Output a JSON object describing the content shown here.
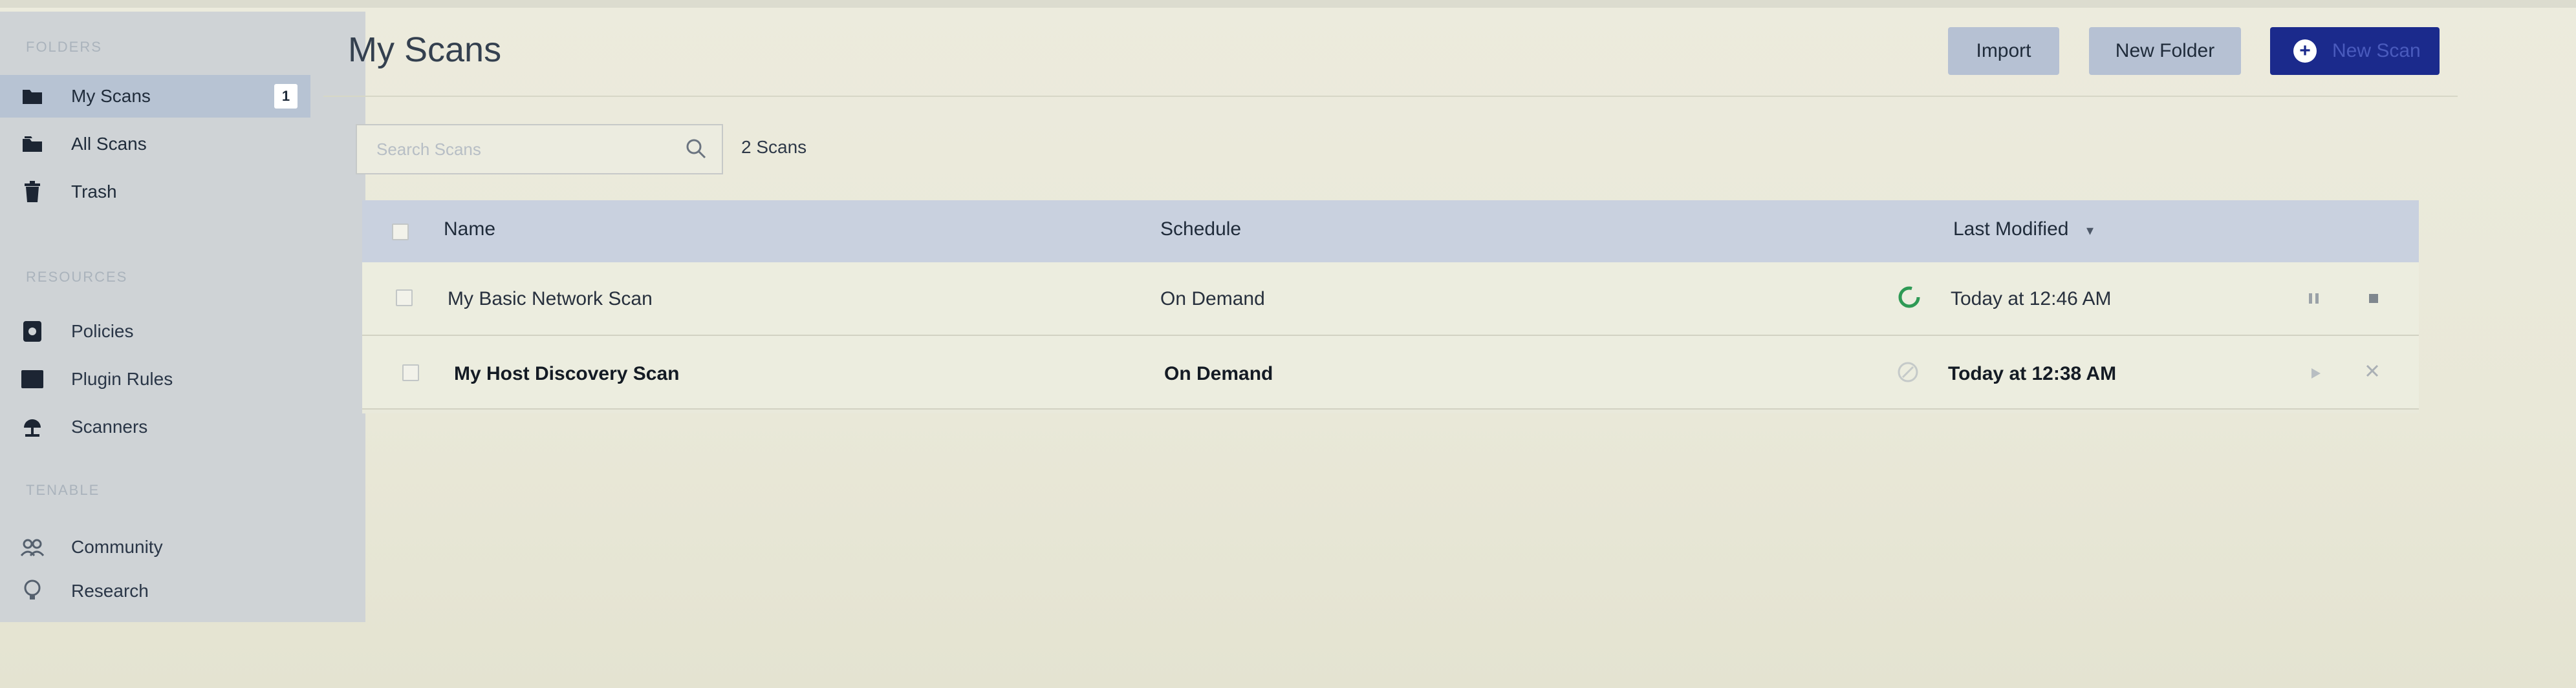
{
  "sidebar": {
    "folders_heading": "FOLDERS",
    "folders": [
      {
        "label": "My Scans",
        "badge": "1",
        "icon": "folder-icon"
      },
      {
        "label": "All Scans",
        "icon": "folders-icon"
      },
      {
        "label": "Trash",
        "icon": "trash-icon"
      }
    ],
    "resources_heading": "RESOURCES",
    "resources": [
      {
        "label": "Policies",
        "icon": "policy-icon"
      },
      {
        "label": "Plugin Rules",
        "icon": "plugin-rules-icon"
      },
      {
        "label": "Scanners",
        "icon": "scanners-icon"
      }
    ],
    "tenable_heading": "TENABLE",
    "tenable": [
      {
        "label": "Community",
        "icon": "community-icon"
      },
      {
        "label": "Research",
        "icon": "research-icon"
      }
    ]
  },
  "header": {
    "title": "My Scans",
    "import_label": "Import",
    "new_folder_label": "New Folder",
    "new_scan_label": "New Scan"
  },
  "toolbar": {
    "search_placeholder": "Search Scans",
    "scan_count": "2 Scans"
  },
  "table": {
    "columns": {
      "name": "Name",
      "schedule": "Schedule",
      "last_modified": "Last Modified",
      "sort_indicator": "▾"
    },
    "rows": [
      {
        "name": "My Basic Network Scan",
        "schedule": "On Demand",
        "status": "running",
        "last_modified": "Today at 12:46 AM",
        "bold": false
      },
      {
        "name": "My Host Discovery Scan",
        "schedule": "On Demand",
        "status": "completed",
        "last_modified": "Today at 12:38 AM",
        "bold": true
      }
    ]
  },
  "colors": {
    "accent": "#1b2a8c",
    "sidebar_bg": "#cfd3d6",
    "status_running": "#2e9a55",
    "table_header": "#c9d1df"
  }
}
